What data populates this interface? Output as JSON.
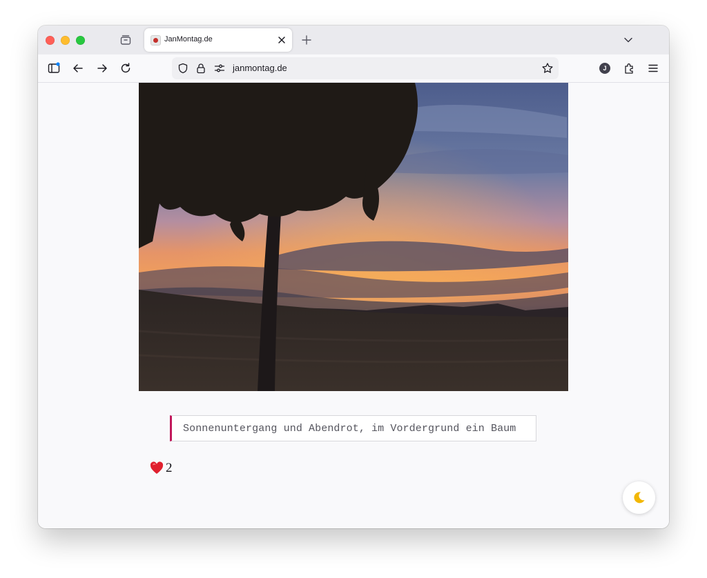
{
  "browser": {
    "tab": {
      "title": "JanMontag.de"
    },
    "address_bar": {
      "url": "janmontag.de"
    },
    "account": {
      "initial": "J"
    },
    "icons": {
      "tab_manager": "tab-manager-icon",
      "close": "close-icon",
      "new_tab": "plus-icon",
      "tab_list": "chevron-down-icon",
      "sidebar": "sidebar-icon",
      "back": "arrow-left-icon",
      "forward": "arrow-right-icon",
      "reload": "reload-icon",
      "shield": "shield-icon",
      "lock": "lock-icon",
      "permissions": "permissions-icon",
      "bookmark": "star-icon",
      "extensions": "puzzle-icon",
      "menu": "hamburger-icon"
    }
  },
  "page": {
    "caption": "Sonnenuntergang und Abendrot, im Vordergrund ein Baum",
    "likes": {
      "count": "2",
      "icon": "heart-icon"
    },
    "theme_toggle": {
      "icon": "moon-icon"
    }
  },
  "colors": {
    "accent": "#c2185b",
    "heart": "#e0202e",
    "moon": "#f2b705"
  }
}
